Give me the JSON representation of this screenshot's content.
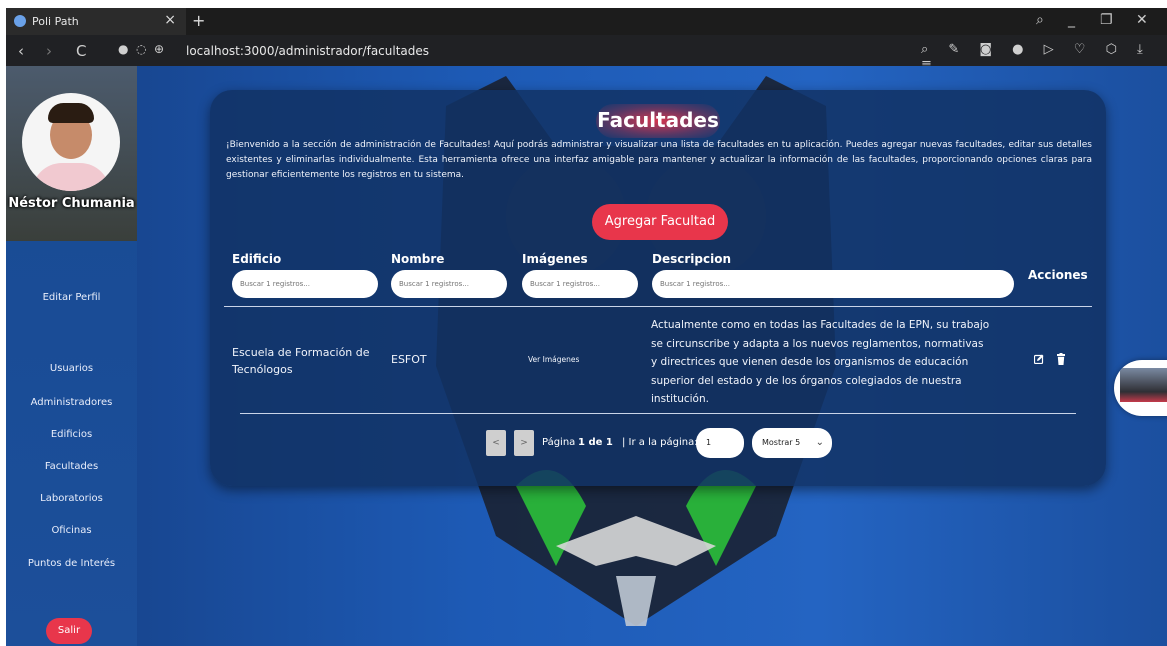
{
  "browser": {
    "tab_title": "Poli Path",
    "tab_close": "×",
    "new_tab": "+",
    "url": "localhost:3000/administrador/facultades",
    "nav": {
      "back": "‹",
      "forward": "›",
      "reload": "C"
    },
    "window_controls": {
      "search": "⌕",
      "minimize": "_",
      "restore": "❐",
      "close": "✕"
    },
    "tools": "⌕ ✎ ◙ ● ▷ ♡ ⬡ ⤓ ≡"
  },
  "sidebar": {
    "user_name": "Néstor Chumania",
    "edit_profile": "Editar Perfil",
    "links": [
      "Usuarios",
      "Administradores",
      "Edificios",
      "Facultades",
      "Laboratorios",
      "Oficinas",
      "Puntos de Interés"
    ],
    "logout": "Salir"
  },
  "main": {
    "title": "Facultades",
    "intro": "¡Bienvenido a la sección de administración de Facultades! Aquí podrás administrar y visualizar una lista de facultades en tu aplicación. Puedes agregar nuevas facultades, editar sus detalles existentes y eliminarlas individualmente. Esta herramienta ofrece una interfaz amigable para mantener y actualizar la información de las facultades, proporcionando opciones claras para gestionar eficientemente los registros en tu sistema.",
    "add_button": "Agregar Facultad",
    "columns": [
      "Edificio",
      "Nombre",
      "Imágenes",
      "Descripcion",
      "Acciones"
    ],
    "filter_placeholder": "Buscar 1 registros...",
    "rows": [
      {
        "edificio": "Escuela de Formación de Tecnólogos",
        "nombre": "ESFOT",
        "imagenes": "Ver Imágenes",
        "descripcion": "Actualmente como en todas las Facultades de la EPN, su trabajo se circunscribe y adapta a los nuevos reglamentos, normativas y directrices que vienen desde los organismos de educación superior del estado y de los órganos colegiados de nuestra institución."
      }
    ],
    "pagination": {
      "prev": "<",
      "next": ">",
      "page_label": "Página",
      "page_current": "1 de 1",
      "goto_label": "| Ir a la página:",
      "goto_value": "1",
      "page_size": "Mostrar 5"
    }
  },
  "colors": {
    "accent": "#e8364b",
    "card": "#123264",
    "sidebar": "#184a93"
  }
}
